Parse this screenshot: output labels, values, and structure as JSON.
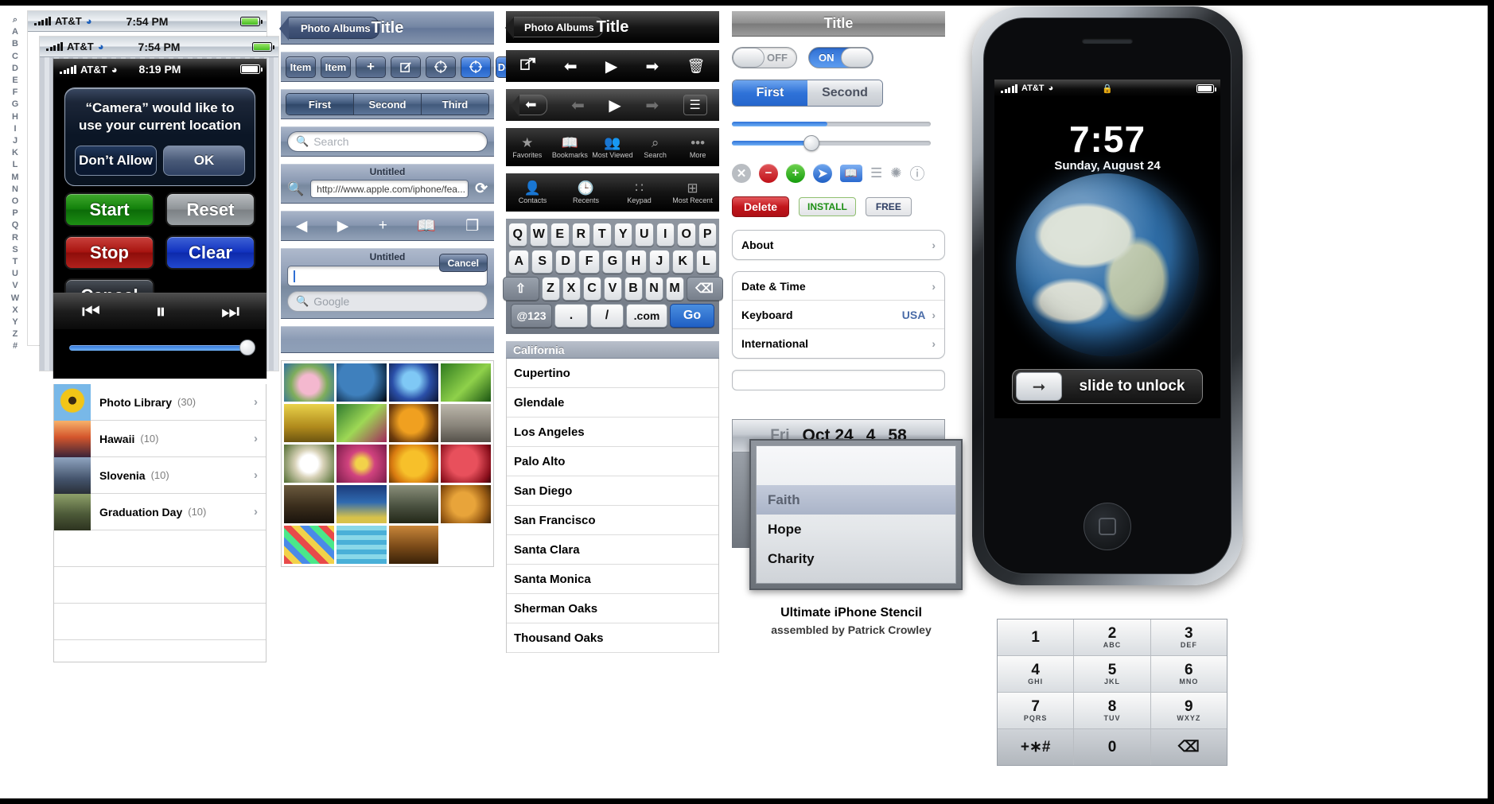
{
  "alpha_index": [
    "Q",
    "A",
    "B",
    "C",
    "D",
    "E",
    "F",
    "G",
    "H",
    "I",
    "J",
    "K",
    "L",
    "M",
    "N",
    "O",
    "P",
    "Q",
    "R",
    "S",
    "T",
    "U",
    "V",
    "W",
    "X",
    "Y",
    "Z",
    "#"
  ],
  "status_bars": {
    "carrier": "AT&T",
    "time_1": "7:54 PM",
    "time_2": "7:54 PM",
    "time_3": "8:19 PM",
    "lock_time_label": "7:57"
  },
  "alert": {
    "message": "“Camera” would like to use your current location",
    "deny_label": "Don’t Allow",
    "accept_label": "OK"
  },
  "big_buttons": [
    {
      "label": "Start",
      "color": "#12800b"
    },
    {
      "label": "Reset",
      "color": "#8f9498"
    },
    {
      "label": "Stop",
      "color": "#a81410"
    },
    {
      "label": "Clear",
      "color": "#1132c0"
    },
    {
      "label": "Cancel",
      "color": "#22262c"
    }
  ],
  "media_controls": [
    "prev-icon",
    "pause-icon",
    "next-icon"
  ],
  "albums": [
    {
      "name": "Photo Library",
      "count": "(30)"
    },
    {
      "name": "Hawaii",
      "count": "(10)"
    },
    {
      "name": "Slovenia",
      "count": "(10)"
    },
    {
      "name": "Graduation Day",
      "count": "(10)"
    }
  ],
  "blue_chrome": {
    "nav": {
      "back_label": "Photo Albums",
      "title": "Title"
    },
    "toolbar_items": [
      "Item",
      "Item",
      "plus-icon",
      "compose-icon",
      "crosshair-icon",
      "crosshair-filled-icon"
    ],
    "toolbar_done": "Done",
    "segmented": [
      "First",
      "Second",
      "Third"
    ],
    "segmented_active": "First",
    "search_placeholder": "Search",
    "url_bar": {
      "title": "Untitled",
      "value": "http:///www.apple.com/iphone/fea...",
      "reload_icon": "reload-icon",
      "search_icon": "search-icon"
    },
    "nav_icons": [
      "back-icon",
      "forward-icon",
      "plus-icon",
      "bookmarks-icon",
      "pages-icon"
    ],
    "cancel_bar": {
      "title": "Untitled",
      "cancel_label": "Cancel"
    },
    "google_placeholder": "Google"
  },
  "black_chrome": {
    "nav": {
      "back_label": "Photo Albums",
      "title": "Title"
    },
    "toolbar_1": [
      "share-icon",
      "back-arrow-icon",
      "play-icon",
      "forward-arrow-icon",
      "trash-icon"
    ],
    "toolbar_2": [
      "back-pill-icon",
      "back-arrow-dim-icon",
      "play-icon",
      "forward-arrow-dim-icon",
      "list-icon"
    ],
    "tabbar_1": [
      {
        "icon": "star-icon",
        "label": "Favorites"
      },
      {
        "icon": "book-icon",
        "label": "Bookmarks"
      },
      {
        "icon": "people-icon",
        "label": "Most Viewed"
      },
      {
        "icon": "search-icon",
        "label": "Search"
      },
      {
        "icon": "more-icon",
        "label": "More"
      }
    ],
    "tabbar_2": [
      {
        "icon": "contact-icon",
        "label": "Contacts"
      },
      {
        "icon": "clock-icon",
        "label": "Recents"
      },
      {
        "icon": "keypad-icon",
        "label": "Keypad"
      },
      {
        "icon": "recent-icon",
        "label": "Most Recent"
      }
    ]
  },
  "keyboard": {
    "row1": [
      "Q",
      "W",
      "E",
      "R",
      "T",
      "Y",
      "U",
      "I",
      "O",
      "P"
    ],
    "row2": [
      "A",
      "S",
      "D",
      "F",
      "G",
      "H",
      "J",
      "K",
      "L"
    ],
    "row3": [
      "shift-icon",
      "Z",
      "X",
      "C",
      "V",
      "B",
      "N",
      "M",
      "backspace-icon"
    ],
    "row4": [
      "@123",
      ".",
      "/",
      ".com",
      "Go"
    ]
  },
  "city_list": {
    "header": "California",
    "cities": [
      "Cupertino",
      "Glendale",
      "Los Angeles",
      "Palo Alto",
      "San Diego",
      "San Francisco",
      "Santa Clara",
      "Santa Monica",
      "Sherman Oaks",
      "Thousand Oaks"
    ]
  },
  "settings": {
    "nav_title": "Title",
    "toggle_off_label": "OFF",
    "toggle_on_label": "ON",
    "segmented": [
      "First",
      "Second"
    ],
    "segmented_active": "First",
    "slider_1_percent": 48,
    "slider_2_percent": 40,
    "icons": [
      "close-circle-icon",
      "minus-circle-icon",
      "plus-circle-icon",
      "arrow-circle-icon",
      "bookmark-icon",
      "list-icon",
      "spinner-icon",
      "info-icon"
    ],
    "pills": {
      "delete": "Delete",
      "install": "INSTALL",
      "free": "FREE"
    },
    "group_1": [
      {
        "label": "About",
        "value": ""
      }
    ],
    "group_2": [
      {
        "label": "Date & Time",
        "value": ""
      },
      {
        "label": "Keyboard",
        "value": "USA"
      },
      {
        "label": "International",
        "value": ""
      }
    ]
  },
  "date_picker": {
    "weekday": "Fri",
    "month_day": "Oct 24",
    "hour": "4",
    "minute": "58",
    "options": [
      "",
      "Faith",
      "Hope",
      "Charity"
    ],
    "selected": "Faith"
  },
  "credit": {
    "line1": "Ultimate iPhone Stencil",
    "line2": "assembled by Patrick Crowley"
  },
  "lock_screen": {
    "time": "7:57",
    "date": "Sunday, August 24",
    "slide_text": "slide to unlock",
    "slide_icon": "arrow-right-icon",
    "lock_icon": "lock-icon"
  },
  "keypad": [
    {
      "n": "1",
      "s": ""
    },
    {
      "n": "2",
      "s": "ABC"
    },
    {
      "n": "3",
      "s": "DEF"
    },
    {
      "n": "4",
      "s": "GHI"
    },
    {
      "n": "5",
      "s": "JKL"
    },
    {
      "n": "6",
      "s": "MNO"
    },
    {
      "n": "7",
      "s": "PQRS"
    },
    {
      "n": "8",
      "s": "TUV"
    },
    {
      "n": "9",
      "s": "WXYZ"
    },
    {
      "n": "+∗#",
      "s": ""
    },
    {
      "n": "0",
      "s": ""
    },
    {
      "n": "⌫",
      "s": ""
    }
  ],
  "colors": {
    "accent_blue": "#2f72d8",
    "green": "#12800b",
    "red": "#c2161c",
    "chrome_blue": "#7385a3"
  }
}
